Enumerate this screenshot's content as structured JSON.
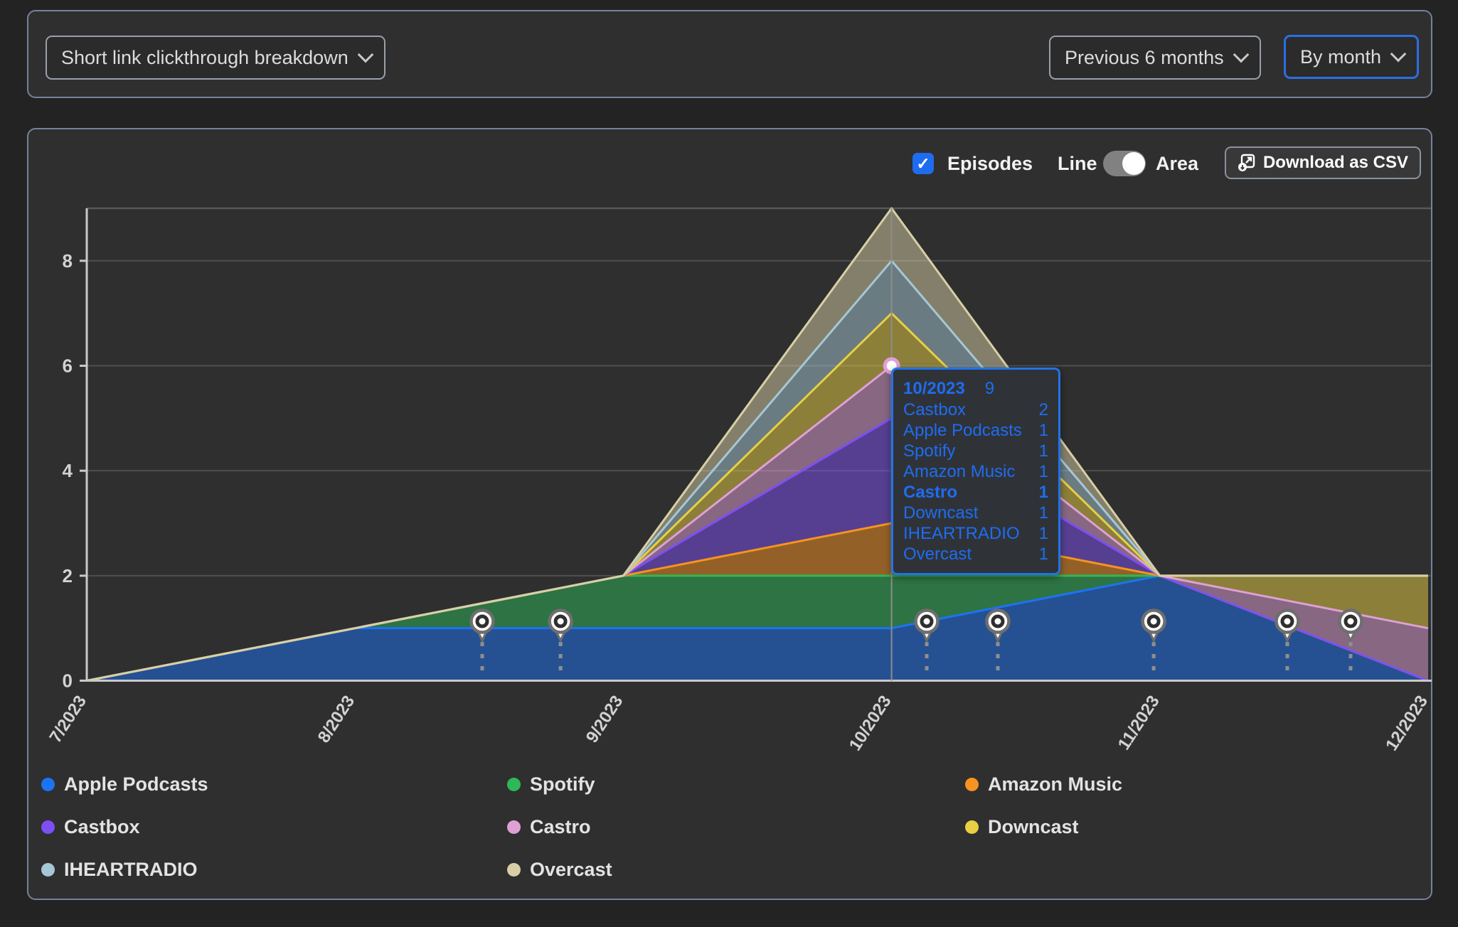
{
  "header": {
    "report_select": "Short link clickthrough breakdown",
    "range_select": "Previous 6 months",
    "granularity_select": "By month"
  },
  "controls": {
    "episodes_label": "Episodes",
    "episodes_checked": true,
    "check_glyph": "✓",
    "line_label": "Line",
    "area_label": "Area",
    "mode": "area",
    "download_label": "Download as CSV"
  },
  "colors": {
    "page_bg": "#232323",
    "card_bg": "#2f2f2f",
    "card_border": "#75829b",
    "accent_blue": "#1f6cf0",
    "axis": "#c9c9c9",
    "gridline": "#4e4e4e",
    "tick_text": "#d2d2d2",
    "marker_gray": "#6e6e6e"
  },
  "chart_data": {
    "type": "area",
    "stacked": true,
    "title": "Short link clickthrough breakdown",
    "x_labels": [
      "7/2023",
      "8/2023",
      "9/2023",
      "10/2023",
      "11/2023",
      "12/2023"
    ],
    "y_ticks": [
      0,
      2,
      4,
      6,
      8
    ],
    "ylim": [
      0,
      9
    ],
    "grid": true,
    "legend_position": "bottom",
    "series": [
      {
        "name": "Apple Podcasts",
        "color": "#1c73f5",
        "values": [
          0,
          1,
          1,
          1,
          2,
          0
        ]
      },
      {
        "name": "Spotify",
        "color": "#2eb857",
        "values": [
          0,
          0,
          1,
          1,
          0,
          0
        ]
      },
      {
        "name": "Amazon Music",
        "color": "#f79320",
        "values": [
          0,
          0,
          0,
          1,
          0,
          0
        ]
      },
      {
        "name": "Castbox",
        "color": "#7e4ff2",
        "values": [
          0,
          0,
          0,
          2,
          0,
          0
        ]
      },
      {
        "name": "Castro",
        "color": "#dfa0d5",
        "values": [
          0,
          0,
          0,
          1,
          0,
          1
        ]
      },
      {
        "name": "Downcast",
        "color": "#e8cf44",
        "values": [
          0,
          0,
          0,
          1,
          0,
          1
        ]
      },
      {
        "name": "IHEARTRADIO",
        "color": "#a6c7d5",
        "values": [
          0,
          0,
          0,
          1,
          0,
          0
        ]
      },
      {
        "name": "Overcast",
        "color": "#d8cfa6",
        "values": [
          0,
          0,
          0,
          1,
          0,
          0
        ]
      }
    ],
    "episode_markers_x": [
      1.474,
      1.766,
      3.131,
      3.396,
      3.977,
      4.475,
      4.711
    ],
    "hover": {
      "x_index": 3,
      "x_label": "10/2023",
      "series": "Castro",
      "cumulative_value": 6
    }
  },
  "tooltip": {
    "title": "10/2023",
    "total": "9",
    "rows": [
      {
        "name": "Castbox",
        "value": "2",
        "bold": false
      },
      {
        "name": "Apple Podcasts",
        "value": "1",
        "bold": false
      },
      {
        "name": "Spotify",
        "value": "1",
        "bold": false
      },
      {
        "name": "Amazon Music",
        "value": "1",
        "bold": false
      },
      {
        "name": "Castro",
        "value": "1",
        "bold": true
      },
      {
        "name": "Downcast",
        "value": "1",
        "bold": false
      },
      {
        "name": "IHEARTRADIO",
        "value": "1",
        "bold": false
      },
      {
        "name": "Overcast",
        "value": "1",
        "bold": false
      }
    ]
  }
}
